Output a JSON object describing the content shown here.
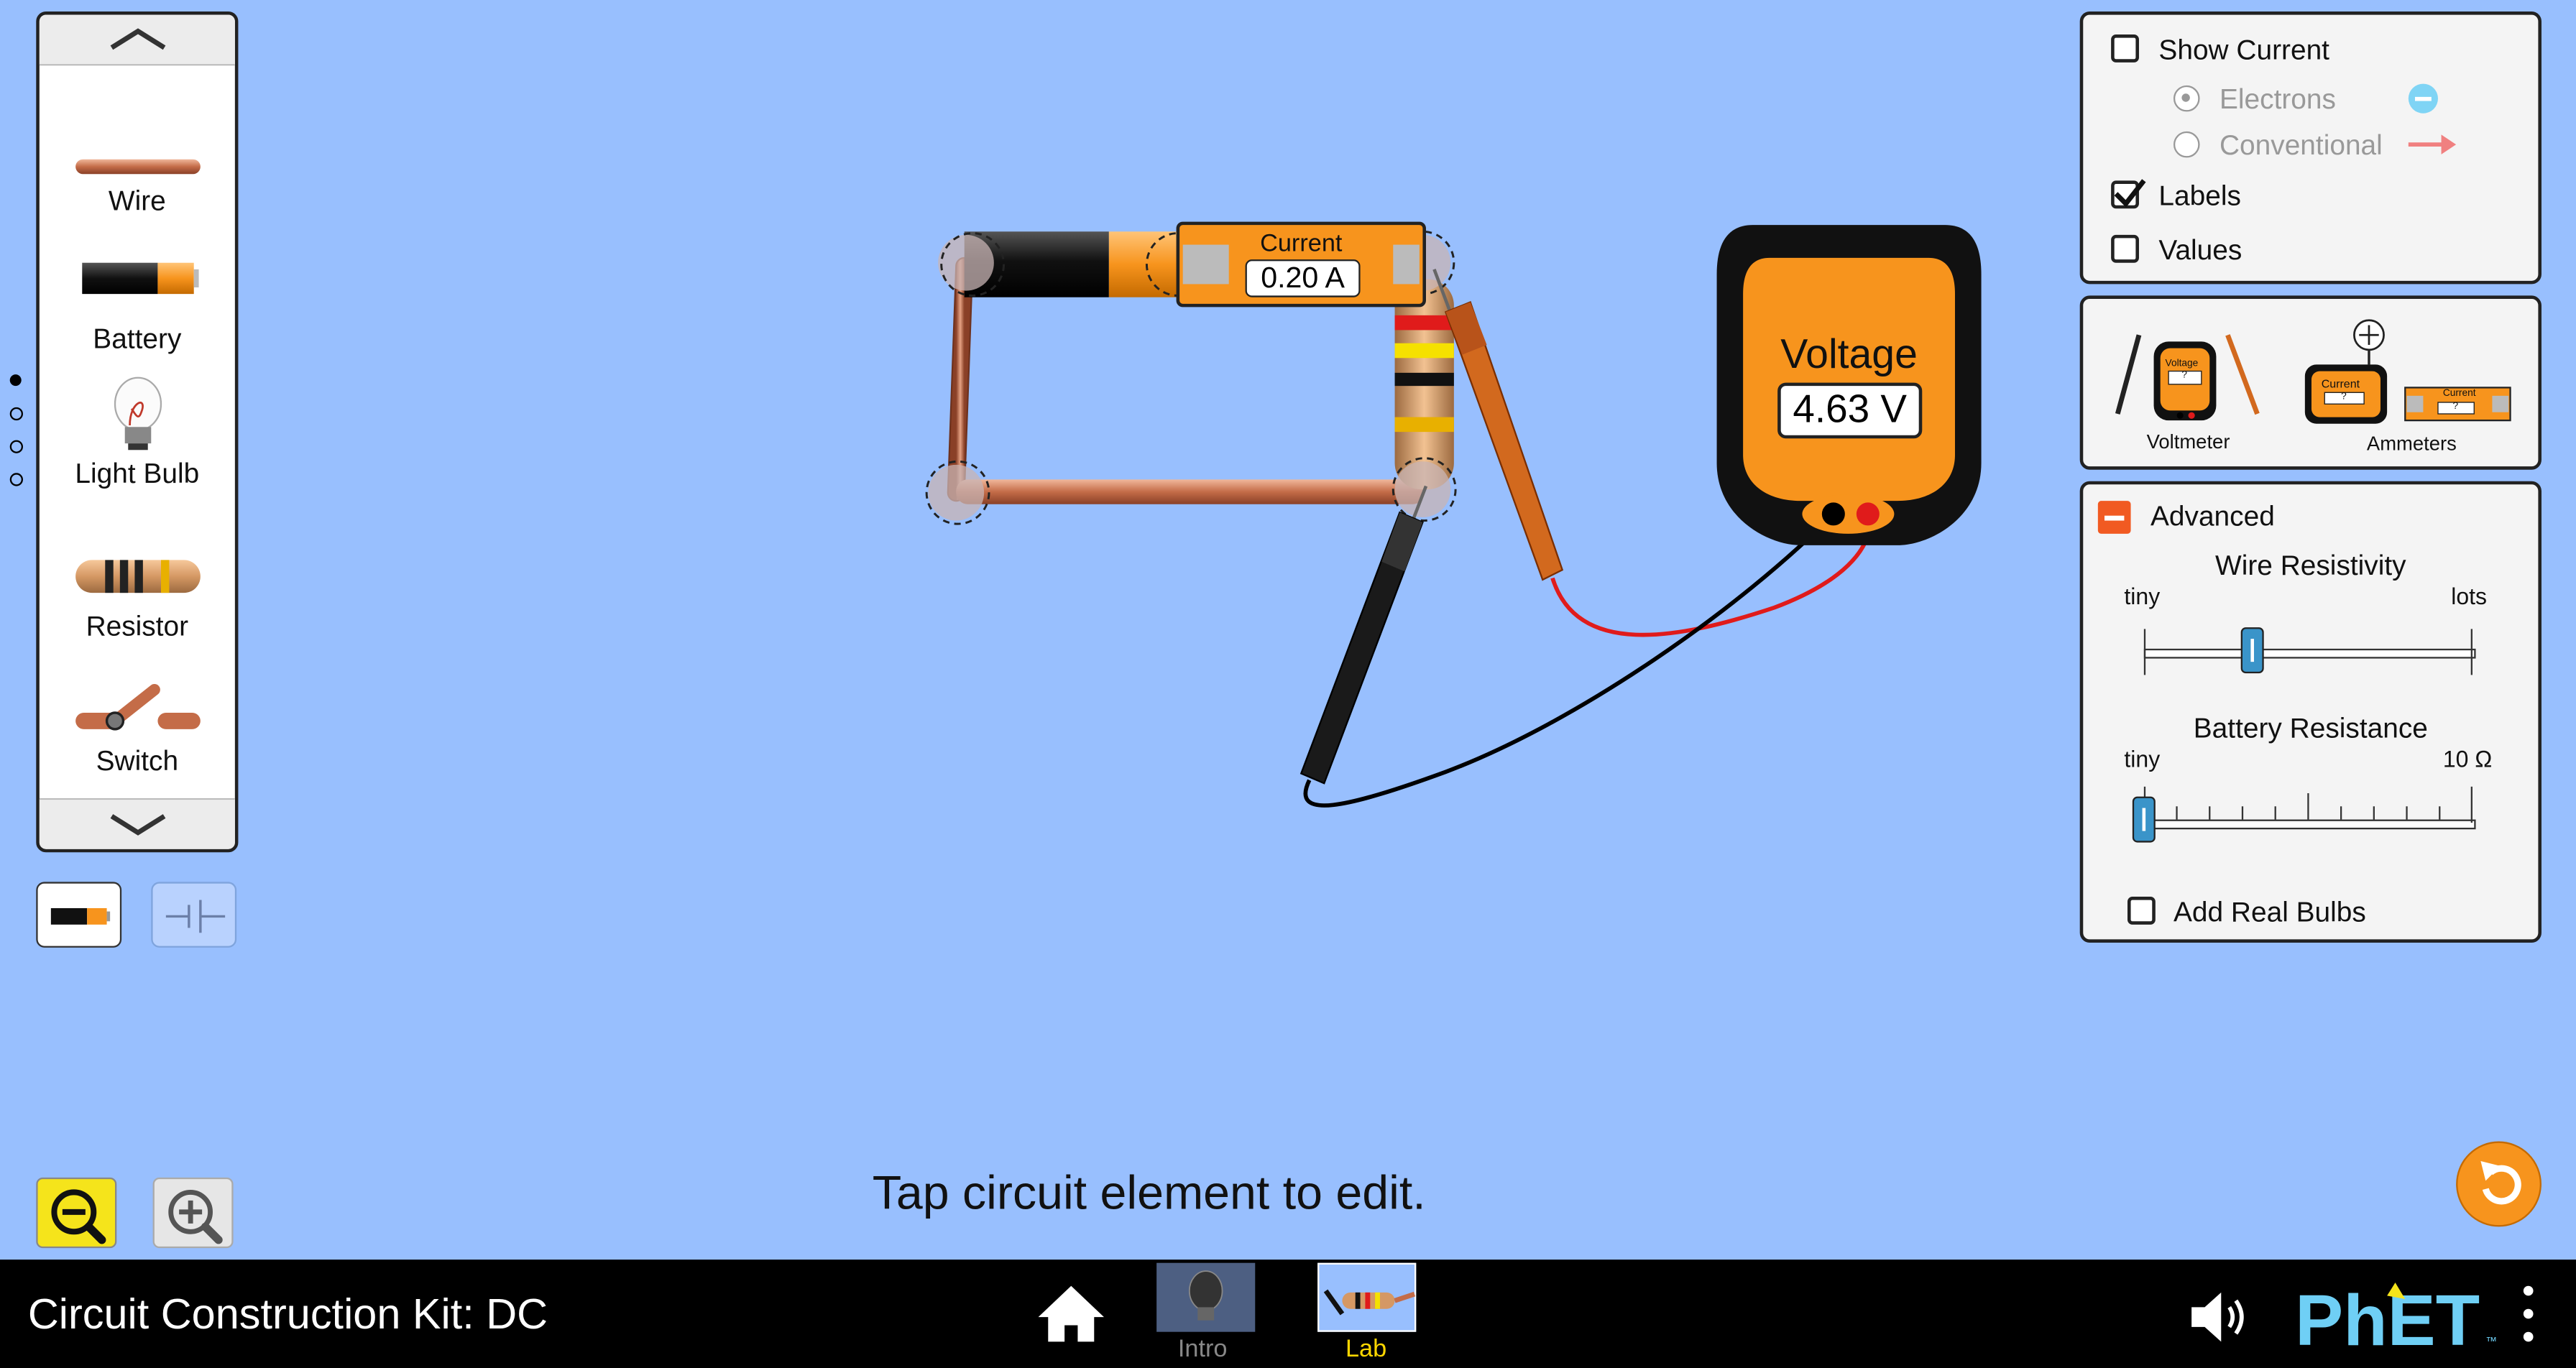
{
  "toolbox": {
    "items": [
      {
        "label": "Wire",
        "icon": "wire-icon"
      },
      {
        "label": "Battery",
        "icon": "battery-icon"
      },
      {
        "label": "Light Bulb",
        "icon": "light-bulb-icon"
      },
      {
        "label": "Resistor",
        "icon": "resistor-icon"
      },
      {
        "label": "Switch",
        "icon": "switch-icon"
      }
    ],
    "page_count": 4,
    "current_page": 1
  },
  "circuit": {
    "ammeter_label": "Current",
    "ammeter_value": "0.20 A"
  },
  "voltmeter": {
    "label": "Voltage",
    "value": "4.63 V"
  },
  "display_panel": {
    "show_current": {
      "label": "Show Current",
      "checked": false
    },
    "electrons": {
      "label": "Electrons",
      "selected": true
    },
    "conventional": {
      "label": "Conventional",
      "selected": false
    },
    "labels": {
      "label": "Labels",
      "checked": true
    },
    "values": {
      "label": "Values",
      "checked": false
    }
  },
  "tools_panel": {
    "voltmeter_label": "Voltmeter",
    "voltmeter_icon_text": "Voltage",
    "voltmeter_icon_value": "?",
    "ammeters_label": "Ammeters",
    "ammeter_icon_text": "Current",
    "ammeter_icon_value": "?"
  },
  "advanced_panel": {
    "title": "Advanced",
    "expanded": true,
    "wire_resistivity": {
      "label": "Wire Resistivity",
      "min_label": "tiny",
      "max_label": "lots",
      "value_fraction": 0.33
    },
    "battery_resistance": {
      "label": "Battery Resistance",
      "min_label": "tiny",
      "max_label": "10 Ω",
      "value_fraction": 0.0
    },
    "add_real_bulbs": {
      "label": "Add Real Bulbs",
      "checked": false
    }
  },
  "hint": "Tap circuit element to edit.",
  "navbar": {
    "title": "Circuit Construction Kit: DC",
    "screens": [
      {
        "label": "Intro",
        "active": false
      },
      {
        "label": "Lab",
        "active": true
      }
    ]
  },
  "colors": {
    "background": "#98bffe",
    "accent_orange": "#f7941d",
    "active_tab_label": "#ffd700",
    "zoom_out_highlight": "#f5e41b",
    "reset_button": "#f7941d"
  }
}
